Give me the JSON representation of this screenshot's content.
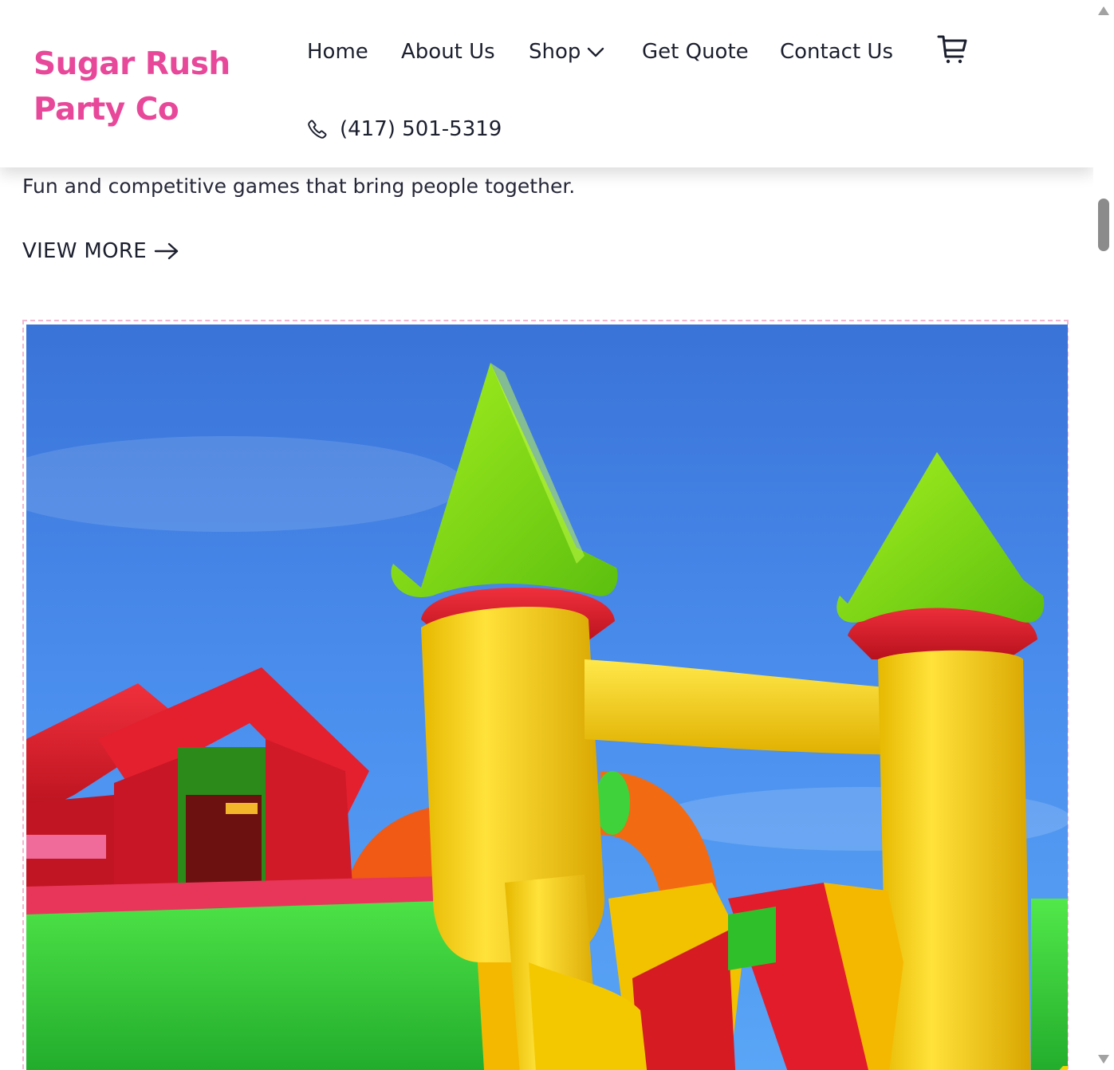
{
  "brand": {
    "name": "Sugar Rush Party Co",
    "color": "#e8489a"
  },
  "nav": {
    "home": "Home",
    "about": "About Us",
    "shop": "Shop",
    "quote": "Get Quote",
    "contact": "Contact Us",
    "cart_icon": "shopping-cart-icon"
  },
  "phone": {
    "number": "(417) 501-5319",
    "icon": "phone-icon"
  },
  "section": {
    "description": "Fun and competitive games that bring people together.",
    "view_more": "VIEW MORE"
  },
  "image": {
    "subject": "inflatable bounce castle",
    "alt": ""
  },
  "colors": {
    "text": "#1b1f2e",
    "accent": "#e8489a",
    "frame_border": "#f3b7cf"
  }
}
